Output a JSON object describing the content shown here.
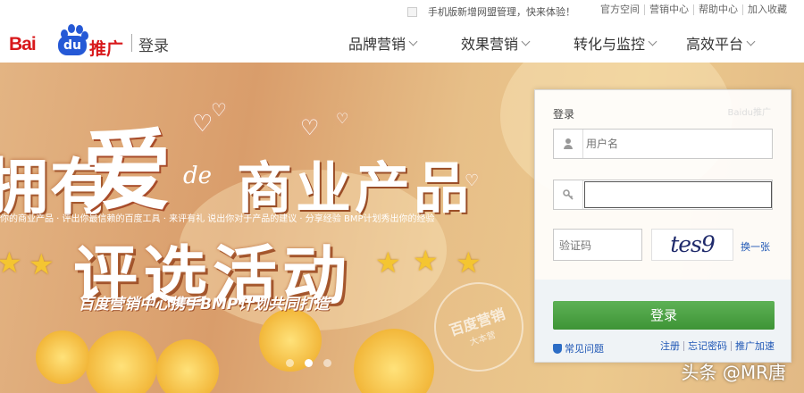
{
  "topbar": {
    "notice": "手机版新增网盟管理，快来体验！",
    "links": [
      "官方空间",
      "营销中心",
      "帮助中心",
      "加入收藏"
    ]
  },
  "header": {
    "logo_text": "Bai",
    "logo_du": "du",
    "logo_product": "推广",
    "page_title": "登录",
    "nav": [
      {
        "label": "品牌营销"
      },
      {
        "label": "效果营销"
      },
      {
        "label": "转化与监控"
      },
      {
        "label": "高效平台"
      }
    ]
  },
  "banner": {
    "line1_left": "拥有",
    "line1_love": "爱",
    "line1_de": "de",
    "line1_right": "商业产品",
    "subtitle": "你的商业产品 · 评出你最信赖的百度工具 · 来评有礼 说出你对于产品的建议 · 分享经验 BMP计划秀出你的经验",
    "headline": "评选活动",
    "tagline": "百度营销中心携手BMP计划共同打造",
    "stamp_big": "百度营销",
    "stamp_small": "大本营",
    "slides": 3,
    "active_slide": 2
  },
  "login": {
    "label": "登录",
    "username_placeholder": "用户名",
    "password_value": "",
    "captcha_placeholder": "验证码",
    "captcha_text": "tes9",
    "refresh_label": "换一张",
    "submit_label": "登录",
    "faq_label": "常见问题",
    "bottom_links": [
      "注册",
      "忘记密码",
      "推广加速"
    ]
  },
  "watermark": "头条 @MR唐",
  "colors": {
    "brand_red": "#d8181b",
    "brand_blue": "#2559d6",
    "button_green": "#4ea345",
    "link_blue": "#1f57b5"
  }
}
